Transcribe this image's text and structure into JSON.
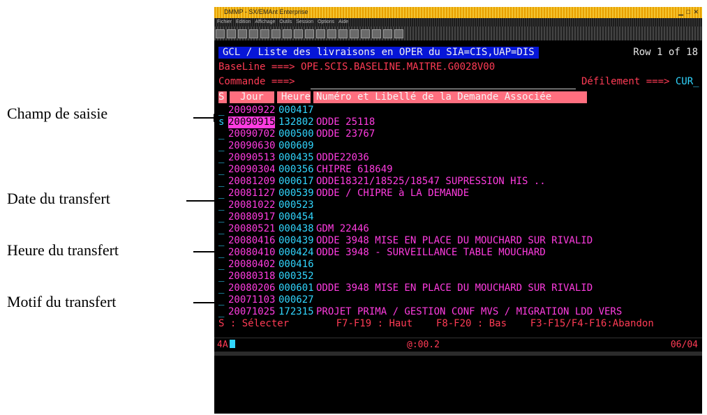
{
  "annotations": [
    {
      "label": "Champ de saisie"
    },
    {
      "label": "Date du transfert"
    },
    {
      "label": "Heure du transfert"
    },
    {
      "label": "Motif du transfert"
    }
  ],
  "window": {
    "title": "DMMP - SX/EMAnt Enterprise",
    "menu": [
      "Fichier",
      "Edition",
      "Affichage",
      "Outils",
      "Session",
      "Options",
      "Aide"
    ]
  },
  "screen": {
    "panel_title": "GCL / Liste des livraisons en OPER du SIA=CIS,UAP=DIS",
    "row_info": "Row 1 of 18",
    "baseline_label": "BaseLine ===>",
    "baseline_value": "OPE.SCIS.BASELINE.MAITRE.G0028V00",
    "command_label": "Commande ===>",
    "scroll_label": "Défilement ===>",
    "scroll_value": "CUR",
    "columns": [
      "S",
      "Jour",
      "Heure",
      "Numéro et Libellé de la Demande Associée"
    ],
    "rows": [
      {
        "s": "_",
        "date": "20090922",
        "time": "000417",
        "motif": ""
      },
      {
        "s": "s",
        "date": "20090915",
        "time": "132802",
        "motif": "ODDE 25118"
      },
      {
        "s": "_",
        "date": "20090702",
        "time": "000500",
        "motif": "ODDE 23767"
      },
      {
        "s": "_",
        "date": "20090630",
        "time": "000609",
        "motif": ""
      },
      {
        "s": "_",
        "date": "20090513",
        "time": "000435",
        "motif": "ODDE22036"
      },
      {
        "s": "_",
        "date": "20090304",
        "time": "000356",
        "motif": "CHIPRE 618649"
      },
      {
        "s": "_",
        "date": "20081209",
        "time": "000617",
        "motif": "ODDE18321/18525/18547 SUPRESSION HIS .."
      },
      {
        "s": "_",
        "date": "20081127",
        "time": "000539",
        "motif": "ODDE / CHIPRE à LA DEMANDE"
      },
      {
        "s": "_",
        "date": "20081022",
        "time": "000523",
        "motif": ""
      },
      {
        "s": "_",
        "date": "20080917",
        "time": "000454",
        "motif": ""
      },
      {
        "s": "_",
        "date": "20080521",
        "time": "000438",
        "motif": "GDM 22446"
      },
      {
        "s": "_",
        "date": "20080416",
        "time": "000439",
        "motif": "ODDE 3948 MISE EN PLACE DU MOUCHARD SUR RIVALID"
      },
      {
        "s": "_",
        "date": "20080410",
        "time": "000424",
        "motif": "ODDE 3948 - SURVEILLANCE TABLE MOUCHARD"
      },
      {
        "s": "_",
        "date": "20080402",
        "time": "000416",
        "motif": ""
      },
      {
        "s": "_",
        "date": "20080318",
        "time": "000352",
        "motif": ""
      },
      {
        "s": "_",
        "date": "20080206",
        "time": "000601",
        "motif": "ODDE 3948 MISE EN PLACE DU MOUCHARD SUR RIVALID"
      },
      {
        "s": "_",
        "date": "20071103",
        "time": "000627",
        "motif": ""
      },
      {
        "s": "_",
        "date": "20071025",
        "time": "172315",
        "motif": "PROJET PRIMA / GESTION CONF MVS / MIGRATION LDD VERS"
      }
    ],
    "footer": {
      "select": "S : Sélecter",
      "up": "F7-F19 : Haut",
      "down": "F8-F20 : Bas",
      "abandon": "F3-F15/F4-F16:Abandon"
    }
  },
  "status": {
    "session": "4A",
    "time": "@:00.2",
    "position": "06/04"
  },
  "colors": {
    "background": "#000000",
    "magenta": "#ff3ce0",
    "cyan": "#31d6ff",
    "red": "#ff3b55",
    "title_blue": "#0616d8",
    "header_pink": "#ff6f7f"
  }
}
